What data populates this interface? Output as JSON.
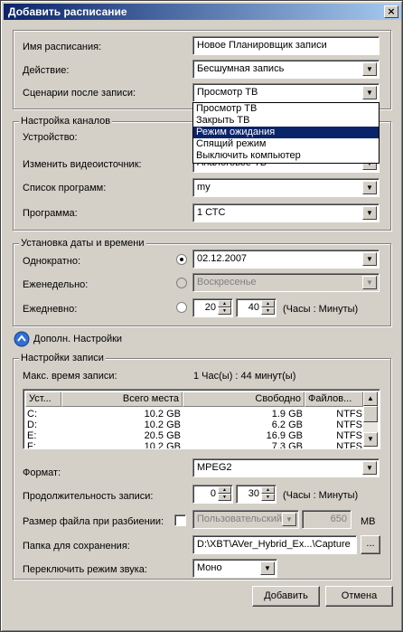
{
  "window": {
    "title": "Добавить расписание",
    "close_glyph": "×"
  },
  "main": {
    "name_label": "Имя расписания:",
    "name_value": "Новое Планировщик записи",
    "action_label": "Действие:",
    "action_value": "Бесшумная запись",
    "after_label": "Сценарии после записи:",
    "after_value": "Просмотр ТВ",
    "after_options": [
      "Просмотр ТВ",
      "Закрыть ТВ",
      "Режим ожидания",
      "Спящий режим",
      "Выключить компьютер"
    ],
    "after_selected_index": 2
  },
  "channels": {
    "group_label": "Настройка каналов",
    "device_label": "Устройство:",
    "source_label": "Изменить видеоисточник:",
    "source_value": "Аналоговое ТВ",
    "programs_label": "Список программ:",
    "programs_value": "my",
    "program_label": "Программа:",
    "program_value": "1 СТС"
  },
  "datetime": {
    "group_label": "Установка даты и времени",
    "once_label": "Однократно:",
    "once_value": "02.12.2007",
    "weekly_label": "Еженедельно:",
    "weekly_value": "Воскресенье",
    "daily_label": "Ежедневно:",
    "daily_hours": "20",
    "daily_minutes": "40",
    "daily_units": "(Часы : Минуты)",
    "selected_mode": "once"
  },
  "advanced": {
    "label": "Дополн. Настройки",
    "icon": "chevron-up-icon"
  },
  "recording": {
    "group_label": "Настройки записи",
    "max_time_label": "Макс. время записи:",
    "max_time_value": "1 Час(ы) : 44 минут(ы)",
    "columns": [
      "Уст...",
      "Всего места",
      "Свободно",
      "Файлов..."
    ],
    "rows": [
      [
        "C:",
        "10.2 GB",
        "1.9 GB",
        "NTFS"
      ],
      [
        "D:",
        "10.2 GB",
        "6.2 GB",
        "NTFS"
      ],
      [
        "E:",
        "20.5 GB",
        "16.9 GB",
        "NTFS"
      ],
      [
        "F:",
        "10.2 GB",
        "7.3 GB",
        "NTFS"
      ]
    ],
    "format_label": "Формат:",
    "format_value": "MPEG2",
    "duration_label": "Продолжительность записи:",
    "duration_hours": "0",
    "duration_minutes": "30",
    "duration_units": "(Часы : Минуты)",
    "split_label": "Размер файла при разбиении:",
    "split_mode": "Пользовательский",
    "split_value": "650",
    "split_units": "MB",
    "folder_label": "Папка для сохранения:",
    "folder_value": "D:\\XBT\\AVer_Hybrid_Ex...\\Capture",
    "folder_browse": "...",
    "sound_label": "Переключить режим звука:",
    "sound_value": "Моно"
  },
  "buttons": {
    "add": "Добавить",
    "cancel": "Отмена"
  }
}
